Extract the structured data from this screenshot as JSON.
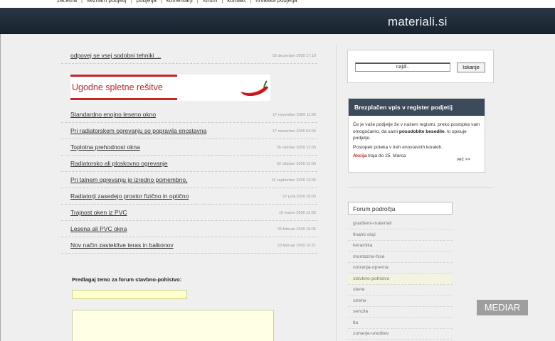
{
  "nav": {
    "items": [
      "začetna",
      "seznam podjetij",
      "podjetja",
      "komentarji",
      "forum",
      "kontakt",
      "hrvaška podjetja"
    ],
    "separator": "|"
  },
  "brand": "materiali.si",
  "top_post": {
    "title": "odpovej se vsej sodobni tehniki ...",
    "date": "02 december 2009 17:19"
  },
  "ad": {
    "text": "Ugodne spletne rešitve",
    "accent_color": "#c42525"
  },
  "posts": [
    {
      "title": "Standardno enojno leseno okno",
      "date": "17 november 2009 11:05"
    },
    {
      "title": "Pri radiatorskem ogrevanju so popravila enostavna",
      "date": "17 november 2009 04:05"
    },
    {
      "title": "Toplotna prehodnost okna",
      "date": "26 oktober 2009 12:05"
    },
    {
      "title": "Radiatorsko ali ploskovno ogrevanje",
      "date": "02 oktober 2009 12:05"
    },
    {
      "title": "Pri talnem ogrevanju je izredno pomembno,",
      "date": "16 september 2009 13:05"
    },
    {
      "title": "Radiatorji zasedejo prostor fizično in optično",
      "date": "07 junij 2009 18:05"
    },
    {
      "title": "Trajnost oken iz PVC",
      "date": "10 marec 2009 13:05"
    },
    {
      "title": "Lesena ali PVC okna",
      "date": "25 februar 2009 18:05"
    },
    {
      "title": "Nov način zastekltve teras in balkonov",
      "date": "23 februar 2009 16:21"
    }
  ],
  "suggest": {
    "label": "Predlagaj temo za forum stavbno-pohistvo:"
  },
  "search": {
    "value": "najdi..",
    "button": "Iskanje"
  },
  "register": {
    "title": "Brezplačen vpis v register podjetij",
    "p1_start": "Če je vaše podjetje že v našem registru, preko postopka vam omogočamo, da sami ",
    "p1_bold": "posodobite besedile",
    "p1_end": ", ki opisuje podjetje.",
    "p2": "Postopek poteka v treh enostavnih korakih.",
    "akcija_label": "Akcija",
    "akcija_text": " traja do 25. Marca",
    "more": "več >>"
  },
  "forum": {
    "title": "Forum področja",
    "items": [
      "gradbeni-materiali",
      "finalni-sloji",
      "keramika",
      "montazne-hise",
      "notranja-oprema",
      "stavbno-pohistvo",
      "stene",
      "strehe",
      "sencila",
      "tla",
      "zunanje-ureditev"
    ],
    "active": "stavbno-pohistvo"
  },
  "overlay_badge": "MEDIAR",
  "colors": {
    "banner": "#1f2a36",
    "accent_red": "#c42525",
    "highlight": "#ffffcc"
  }
}
